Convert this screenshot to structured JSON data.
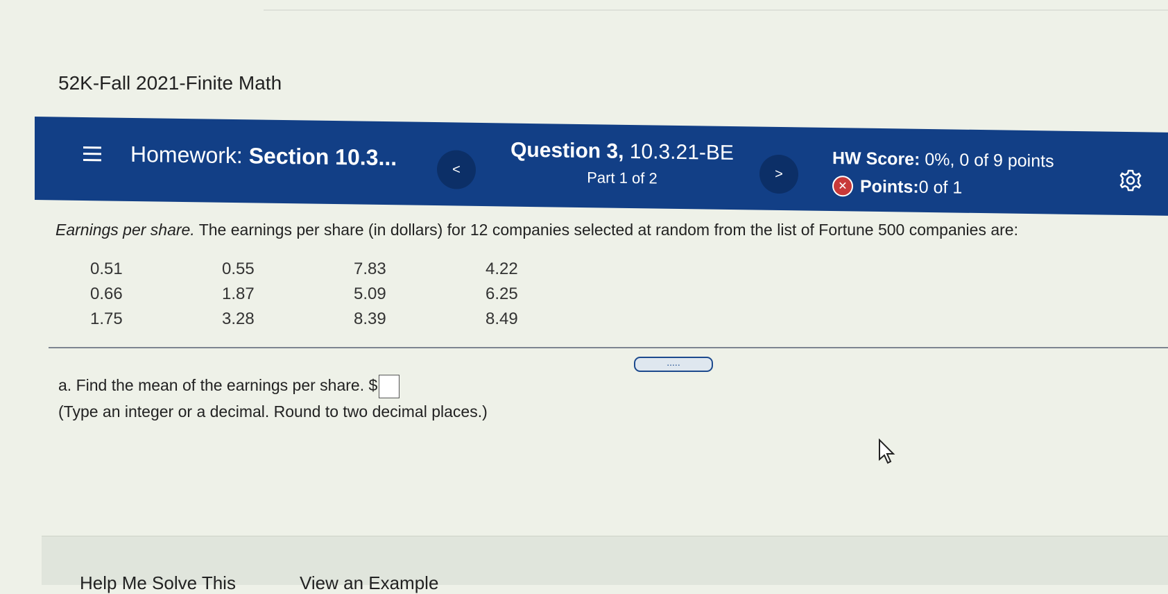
{
  "course": {
    "title": "52K-Fall 2021-Finite Math"
  },
  "header": {
    "homework_prefix": "Homework: ",
    "homework_section": "Section 10.3...",
    "prev_label": "<",
    "next_label": ">",
    "question_title": "Question 3,",
    "question_code": " 10.3.21-BE",
    "question_part": "Part 1 of 2",
    "hw_score_label": "HW Score:",
    "hw_score_value": " 0%, 0 of 9 points",
    "points_label": "Points:",
    "points_value": " 0 of 1",
    "x_badge": "✕"
  },
  "problem": {
    "title": "Earnings per share.",
    "text": " The earnings per share (in dollars) for 12 companies selected at random from the list of Fortune 500 companies are:",
    "data": [
      [
        "0.51",
        "0.55",
        "7.83",
        "4.22"
      ],
      [
        "0.66",
        "1.87",
        "5.09",
        "6.25"
      ],
      [
        "1.75",
        "3.28",
        "8.39",
        "8.49"
      ]
    ]
  },
  "expand_handle": {
    "label": "....."
  },
  "part_a": {
    "prompt": "a. Find the mean of the earnings per share. $",
    "hint": "(Type an integer or a decimal. Round to two decimal places.)"
  },
  "footer": {
    "help_button": "Help Me Solve This",
    "example_button": "View an Example"
  }
}
